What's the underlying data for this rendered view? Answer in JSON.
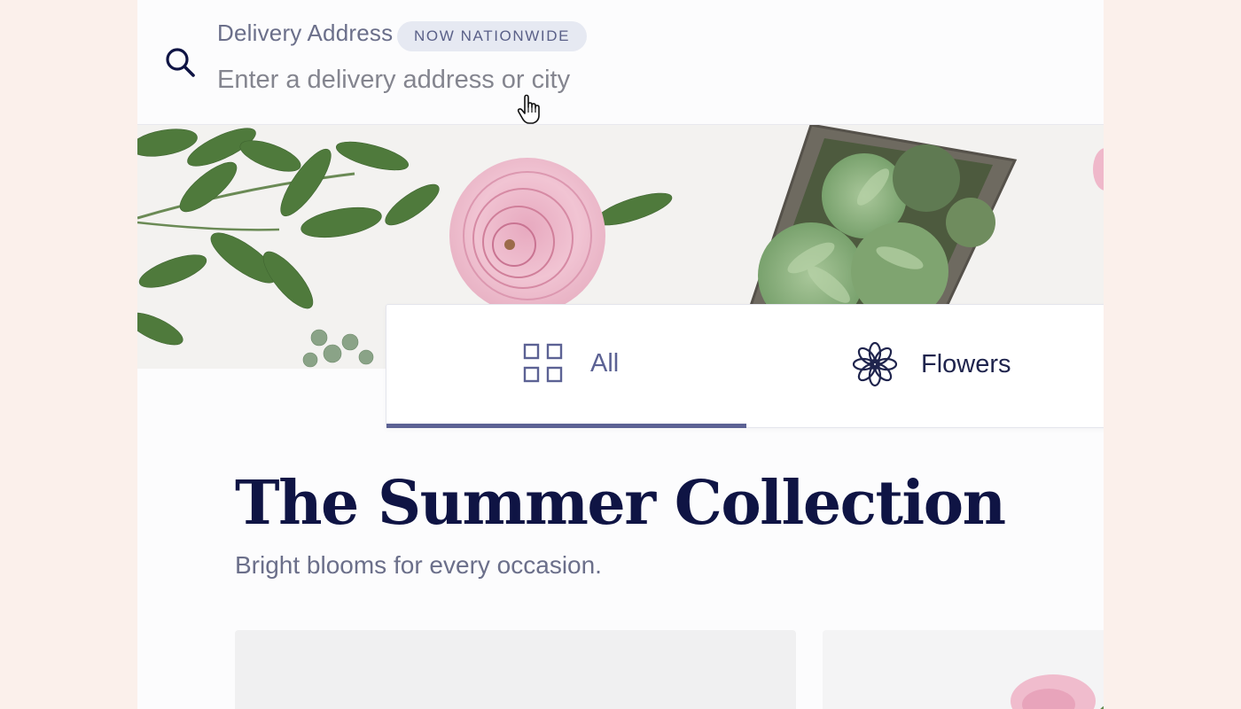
{
  "address": {
    "label": "Delivery Address",
    "badge": "NOW NATIONWIDE",
    "placeholder": "Enter a delivery address or city"
  },
  "categories": {
    "tabs": [
      {
        "label": "All",
        "icon": "grid-icon",
        "active": true
      },
      {
        "label": "Flowers",
        "icon": "flower-icon",
        "active": false
      }
    ]
  },
  "collection": {
    "title": "The Summer Collection",
    "subtitle": "Bright blooms for every occasion."
  },
  "colors": {
    "page_background": "#fbf0eb",
    "navy": "#0f1444",
    "accent": "#5c6294",
    "muted_text": "#6b6f8a",
    "badge_background": "#e6e9f2"
  }
}
